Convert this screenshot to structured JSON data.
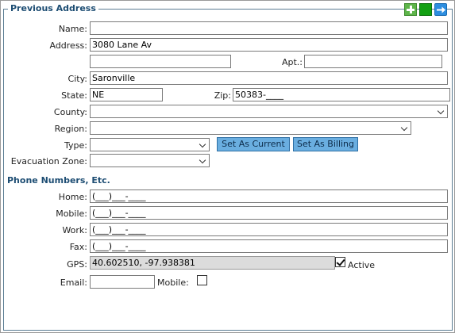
{
  "section_title": "Previous Address",
  "toolbar": {
    "add_icon": "plus-icon",
    "save_icon": "save-icon",
    "next_icon": "arrow-right-icon"
  },
  "labels": {
    "name": "Name:",
    "address": "Address:",
    "apt": "Apt.:",
    "city": "City:",
    "state": "State:",
    "zip": "Zip:",
    "county": "County:",
    "region": "Region:",
    "type": "Type:",
    "evacuation_zone": "Evacuation Zone:"
  },
  "fields": {
    "name": "",
    "address1": "3080 Lane Av",
    "address2": "",
    "apt": "",
    "city": "Saronville",
    "state": "NE",
    "zip": "50383-____",
    "county": "",
    "region": "",
    "type": "",
    "evacuation_zone": ""
  },
  "buttons": {
    "set_current": "Set As Current",
    "set_billing": "Set As Billing"
  },
  "phone_section": {
    "title": "Phone Numbers, Etc.",
    "labels": {
      "home": "Home:",
      "mobile": "Mobile:",
      "work": "Work:",
      "fax": "Fax:",
      "gps": "GPS:",
      "email": "Email:",
      "email_mobile": "Mobile:"
    },
    "values": {
      "home": "(___)___-____",
      "mobile": "(___)___-____",
      "work": "(___)___-____",
      "fax": "(___)___-____",
      "gps": "40.602510, -97.938381",
      "email": ""
    },
    "active_label": "Active",
    "active_checked": true,
    "email_mobile_checked": false
  }
}
